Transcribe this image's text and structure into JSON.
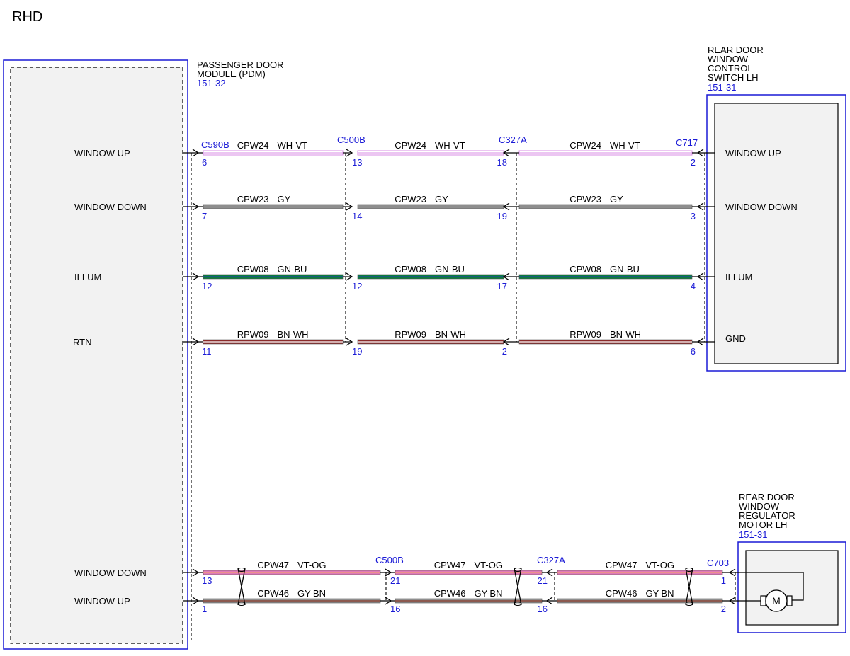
{
  "page_label": "RHD",
  "colors": {
    "module_border": "#1a1ad6",
    "connector_text": "#1a1ad6",
    "WH-VT": [
      "#ffffff",
      "#d98ee6"
    ],
    "GY": [
      "#8e8e8e",
      "#8e8e8e"
    ],
    "GN-BU": [
      "#0e7a3c",
      "#1c4aa8"
    ],
    "BN-WH": [
      "#8a2a2a",
      "#ffffff"
    ],
    "VT-OG": [
      "#e07ab8",
      "#f0a070"
    ],
    "GY-BN": [
      "#8e8e8e",
      "#8a3a2a"
    ]
  },
  "modules": {
    "pdm": {
      "name_lines": [
        "PASSENGER DOOR",
        "MODULE (PDM)"
      ],
      "ref": "151-32",
      "pins": [
        "WINDOW UP",
        "WINDOW DOWN",
        "ILLUM",
        "RTN",
        "WINDOW DOWN",
        "WINDOW UP"
      ]
    },
    "switch": {
      "name_lines": [
        "REAR DOOR",
        "WINDOW",
        "CONTROL",
        "SWITCH LH"
      ],
      "ref": "151-31",
      "pins": [
        "WINDOW UP",
        "WINDOW DOWN",
        "ILLUM",
        "GND"
      ]
    },
    "motor": {
      "name_lines": [
        "REAR DOOR",
        "WINDOW",
        "REGULATOR",
        "MOTOR LH"
      ],
      "ref": "151-31",
      "symbol": "M"
    }
  },
  "connectors": {
    "upper": [
      "C590B",
      "C500B",
      "C327A",
      "C717"
    ],
    "lower": [
      "C500B",
      "C327A",
      "C703"
    ]
  },
  "circuits": [
    {
      "id": "CPW24",
      "color": "WH-VT",
      "pins": [
        "6",
        "13",
        "18",
        "2"
      ]
    },
    {
      "id": "CPW23",
      "color": "GY",
      "pins": [
        "7",
        "14",
        "19",
        "3"
      ]
    },
    {
      "id": "CPW08",
      "color": "GN-BU",
      "pins": [
        "12",
        "12",
        "17",
        "4"
      ]
    },
    {
      "id": "RPW09",
      "color": "BN-WH",
      "pins": [
        "11",
        "19",
        "2",
        "6"
      ]
    },
    {
      "id": "CPW47",
      "color": "VT-OG",
      "pins": [
        "13",
        "21",
        "21",
        "1"
      ]
    },
    {
      "id": "CPW46",
      "color": "GY-BN",
      "pins": [
        "1",
        "16",
        "16",
        "2"
      ]
    }
  ]
}
